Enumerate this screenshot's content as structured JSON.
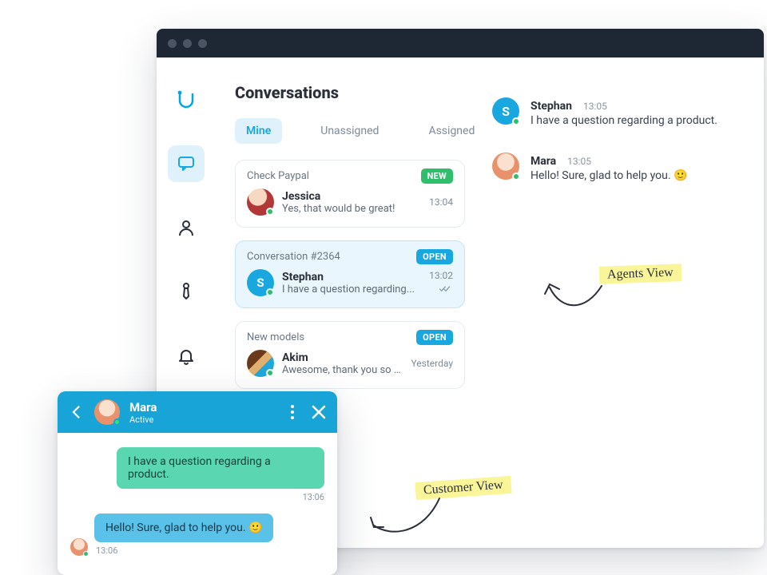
{
  "window": {
    "title": "Conversations"
  },
  "nav": {
    "items": [
      {
        "id": "conversations",
        "active": true
      },
      {
        "id": "contacts"
      },
      {
        "id": "agents"
      },
      {
        "id": "notifications"
      }
    ]
  },
  "tabs": {
    "mine": "Mine",
    "unassigned": "Unassigned",
    "assigned": "Assigned",
    "active": "mine"
  },
  "conversations": [
    {
      "title": "Check Paypal",
      "badge": "NEW",
      "badge_type": "new",
      "name": "Jessica",
      "preview": "Yes, that would be great!",
      "time": "13:04",
      "selected": false,
      "avatar_letter": "",
      "avatar_class": "av-jessica"
    },
    {
      "title": "Conversation #2364",
      "badge": "OPEN",
      "badge_type": "open",
      "name": "Stephan",
      "preview": "I have a question regarding...",
      "time": "13:02",
      "selected": true,
      "avatar_letter": "S",
      "avatar_class": "av-s",
      "read": true
    },
    {
      "title": "New models",
      "badge": "OPEN",
      "badge_type": "open",
      "name": "Akim",
      "preview": "Awesome, thank you so much.",
      "time": "Yesterday",
      "selected": false,
      "avatar_letter": "",
      "avatar_class": "av-akim"
    }
  ],
  "agent_chat": [
    {
      "name": "Stephan",
      "time": "13:05",
      "text": "I have a question regarding a product.",
      "avatar_letter": "S",
      "avatar_class": "av-s"
    },
    {
      "name": "Mara",
      "time": "13:05",
      "text": "Hello! Sure, glad to help you. 🙂",
      "avatar_letter": "",
      "avatar_class": "av-mara"
    }
  ],
  "notes": {
    "agents": "Agents View",
    "customer": "Customer View"
  },
  "widget": {
    "agent_name": "Mara",
    "agent_status": "Active",
    "messages": [
      {
        "side": "right",
        "text": "I have a question regarding a product.",
        "time": "13:06"
      },
      {
        "side": "left",
        "text": "Hello! Sure, glad to help you. 🙂",
        "time": "13:06",
        "avatar_class": "av-mara"
      }
    ]
  }
}
